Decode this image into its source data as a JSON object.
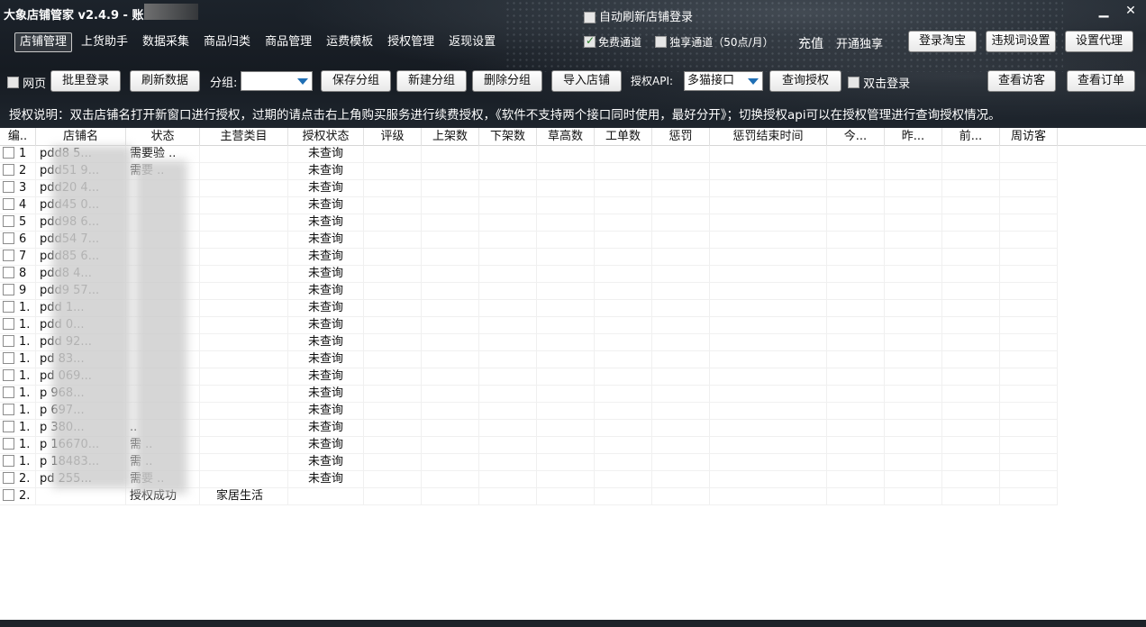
{
  "window": {
    "title": "大象店铺管家 v2.4.9 - 账",
    "minimize": "▁",
    "close": "✕"
  },
  "top": {
    "auto_refresh_label": "自动刷新店铺登录"
  },
  "menu": [
    {
      "label": "店铺管理",
      "active": true
    },
    {
      "label": "上货助手"
    },
    {
      "label": "数据采集"
    },
    {
      "label": "商品归类"
    },
    {
      "label": "商品管理"
    },
    {
      "label": "运费模板"
    },
    {
      "label": "授权管理"
    },
    {
      "label": "返现设置"
    }
  ],
  "channels": {
    "free_label": "免费通道",
    "exclusive_label": "独享通道（50点/月）",
    "recharge": "充值",
    "open_exclusive": "开通独享"
  },
  "header_buttons": {
    "login_taobao": "登录淘宝",
    "banned_words": "违规词设置",
    "proxy": "设置代理"
  },
  "toolbar": {
    "web_label": "网页",
    "batch_login": "批里登录",
    "refresh": "刷新数据",
    "group_label": "分组:",
    "group_value": "",
    "save_group": "保存分组",
    "new_group": "新建分组",
    "delete_group": "删除分组",
    "import_shop": "导入店铺",
    "api_label": "授权API:",
    "api_value": "多猫接口",
    "query_auth": "查询授权",
    "double_click_label": "双击登录",
    "view_visitors": "查看访客",
    "view_orders": "查看订单"
  },
  "notice": "授权说明：双击店铺名打开新窗口进行授权，过期的请点击右上角购买服务进行续费授权，《软件不支持两个接口同时使用，最好分开》；切换授权api可以在授权管理进行查询授权情况。",
  "table": {
    "columns": [
      "编..",
      "店铺名",
      "状态",
      "主营类目",
      "授权状态",
      "评级",
      "上架数",
      "下架数",
      "草高数",
      "工单数",
      "惩罚",
      "惩罚结束时间",
      "今...",
      "昨...",
      "前...",
      "周访客"
    ],
    "rows": [
      {
        "num": "1",
        "shop": "pdd8  5...",
        "status": "需要验 ..",
        "category": "",
        "auth": "未查询"
      },
      {
        "num": "2",
        "shop": "pdd51  9...",
        "status": "需要  ..",
        "category": "",
        "auth": "未查询"
      },
      {
        "num": "3",
        "shop": "pdd20  4...",
        "status": "",
        "category": "",
        "auth": "未查询"
      },
      {
        "num": "4",
        "shop": "pdd45  0...",
        "status": "",
        "category": "",
        "auth": "未查询"
      },
      {
        "num": "5",
        "shop": "pdd98  6...",
        "status": "",
        "category": "",
        "auth": "未查询"
      },
      {
        "num": "6",
        "shop": "pdd54  7...",
        "status": "",
        "category": "",
        "auth": "未查询"
      },
      {
        "num": "7",
        "shop": "pdd85  6...",
        "status": "",
        "category": "",
        "auth": "未查询"
      },
      {
        "num": "8",
        "shop": "pdd8  4...",
        "status": "",
        "category": "",
        "auth": "未查询"
      },
      {
        "num": "9",
        "shop": "pdd9  57...",
        "status": "",
        "category": "",
        "auth": "未查询"
      },
      {
        "num": "1.",
        "shop": "pdd  1...",
        "status": "",
        "category": "",
        "auth": "未查询"
      },
      {
        "num": "1.",
        "shop": "pdd  0...",
        "status": "",
        "category": "",
        "auth": "未查询"
      },
      {
        "num": "1.",
        "shop": "pdd  92...",
        "status": "",
        "category": "",
        "auth": "未查询"
      },
      {
        "num": "1.",
        "shop": "pd  83...",
        "status": "",
        "category": "",
        "auth": "未查询"
      },
      {
        "num": "1.",
        "shop": "pd  069...",
        "status": "",
        "category": "",
        "auth": "未查询"
      },
      {
        "num": "1.",
        "shop": "p  968...",
        "status": "",
        "category": "",
        "auth": "未查询"
      },
      {
        "num": "1.",
        "shop": "p  697...",
        "status": "",
        "category": "",
        "auth": "未查询"
      },
      {
        "num": "1.",
        "shop": "p  380...",
        "status": "  ..",
        "category": "",
        "auth": "未查询"
      },
      {
        "num": "1.",
        "shop": "p  16670...",
        "status": "需  ..",
        "category": "",
        "auth": "未查询"
      },
      {
        "num": "1.",
        "shop": "p  18483...",
        "status": "需  ..",
        "category": "",
        "auth": "未查询"
      },
      {
        "num": "2.",
        "shop": "pd  255...",
        "status": "需要  ..",
        "category": "",
        "auth": "未查询"
      },
      {
        "num": "2.",
        "shop": "",
        "status": "授权成功",
        "category": "家居生活",
        "auth": ""
      }
    ]
  }
}
